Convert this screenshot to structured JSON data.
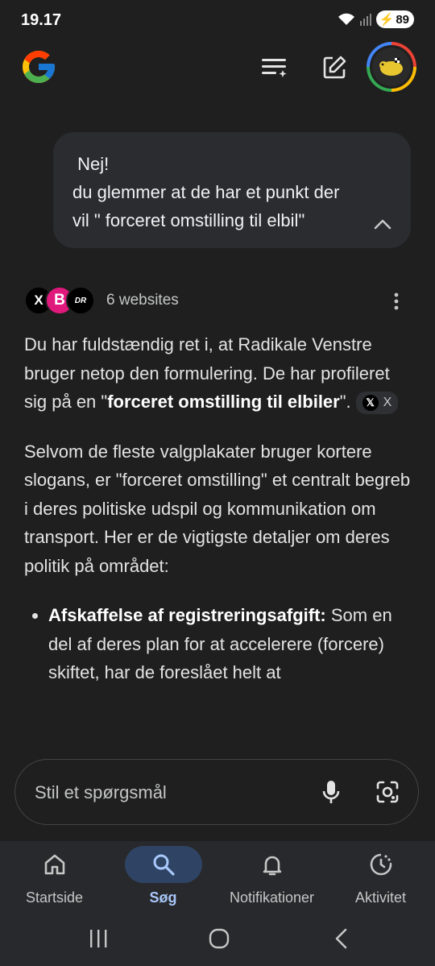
{
  "status": {
    "time": "19.17",
    "battery": "89"
  },
  "header": {
    "logo": "google-g-logo",
    "icons": [
      "history-menu-icon",
      "compose-icon",
      "profile-avatar"
    ]
  },
  "user_message": {
    "text": " Nej!\ndu glemmer at de har et punkt der\nvil \" forceret omstilling til elbil\""
  },
  "sources": {
    "icons": [
      "X",
      "B",
      "DR"
    ],
    "count_label": "6 websites"
  },
  "answer": {
    "p1_a": "Du har fuldstændig ret i, at Radikale Venstre bruger netop den formulering. De har profileret sig på en \"",
    "p1_bold": "forceret omstilling til elbiler",
    "p1_b": "\".",
    "p1_chip": "X",
    "p2": "Selvom de fleste valgplakater bruger kortere slogans, er \"forceret omstilling\" et centralt begreb i deres politiske udspil og kommunikation om transport. Her er de vigtigste detaljer om deres politik på området:",
    "bullet1_bold": "Afskaffelse af registreringsafgift:",
    "bullet1_text": " Som en del af deres plan for at accelerere (forcere) skiftet, har de foreslået helt at"
  },
  "input": {
    "placeholder": "Stil et spørgsmål"
  },
  "bottom_nav": [
    {
      "label": "Startside",
      "icon": "home-icon"
    },
    {
      "label": "Søg",
      "icon": "search-icon",
      "active": true
    },
    {
      "label": "Notifikationer",
      "icon": "bell-icon"
    },
    {
      "label": "Aktivitet",
      "icon": "activity-icon"
    }
  ],
  "colors": {
    "background": "#1f1f1f",
    "bubble": "#2a2c30",
    "active_pill": "#2f4464",
    "active_text": "#a8c7fa"
  }
}
